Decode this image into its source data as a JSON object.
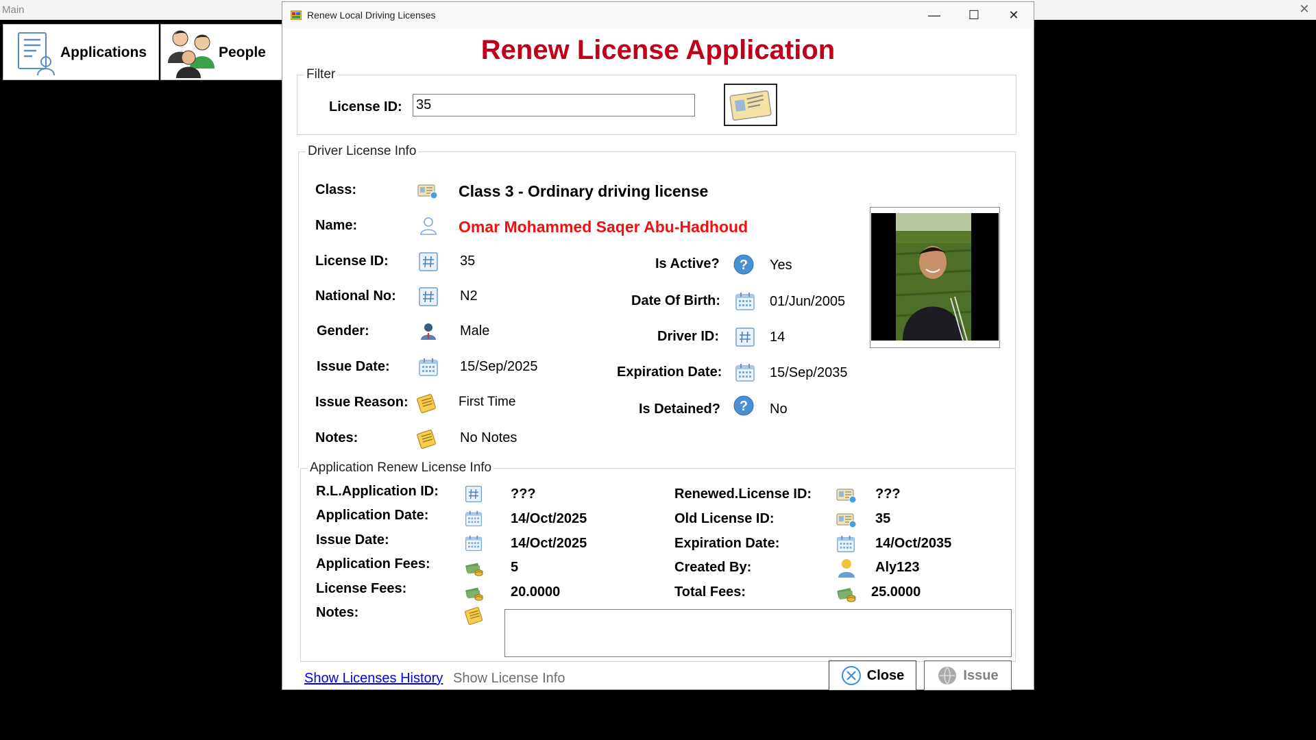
{
  "main_window": {
    "title": "Main",
    "close_glyph": "✕",
    "toolbar": {
      "applications_label": "Applications",
      "people_label": "People"
    }
  },
  "dialog": {
    "title": "Renew Local Driving Licenses",
    "controls": {
      "minimize": "—",
      "maximize": "☐",
      "close": "✕"
    },
    "heading": "Renew License Application",
    "heading_color": "#c0001b",
    "filter": {
      "group_title": "Filter",
      "license_id_label": "License ID:",
      "license_id_value": "35"
    },
    "driver_license_info": {
      "group_title": "Driver License Info",
      "class_label": "Class:",
      "class_value": "Class 3 - Ordinary driving license",
      "name_label": "Name:",
      "name_value": "Omar Mohammed Saqer Abu-Hadhoud",
      "license_id_label": "License ID:",
      "license_id_value": "35",
      "national_no_label": "National No:",
      "national_no_value": "N2",
      "gender_label": "Gender:",
      "gender_value": "Male",
      "issue_date_label": "Issue Date:",
      "issue_date_value": "15/Sep/2025",
      "issue_reason_label": "Issue Reason:",
      "issue_reason_value": "First Time",
      "notes_label": "Notes:",
      "notes_value": "No Notes",
      "is_active_label": "Is Active?",
      "is_active_value": "Yes",
      "date_of_birth_label": "Date Of Birth:",
      "date_of_birth_value": "01/Jun/2005",
      "driver_id_label": "Driver ID:",
      "driver_id_value": "14",
      "expiration_date_label": "Expiration Date:",
      "expiration_date_value": "15/Sep/2035",
      "is_detained_label": "Is Detained?",
      "is_detained_value": "No"
    },
    "application_renew_info": {
      "group_title": "Application Renew License Info",
      "rl_application_id_label": "R.L.Application ID:",
      "rl_application_id_value": "???",
      "application_date_label": "Application Date:",
      "application_date_value": "14/Oct/2025",
      "issue_date_label": "Issue Date:",
      "issue_date_value": "14/Oct/2025",
      "application_fees_label": "Application Fees:",
      "application_fees_value": "5",
      "license_fees_label": "License Fees:",
      "license_fees_value": "20.0000",
      "notes_label": "Notes:",
      "notes_value": "",
      "renewed_license_id_label": "Renewed.License ID:",
      "renewed_license_id_value": "???",
      "old_license_id_label": "Old License ID:",
      "old_license_id_value": "35",
      "expiration_date_label": "Expiration Date:",
      "expiration_date_value": "14/Oct/2035",
      "created_by_label": "Created By:",
      "created_by_value": "Aly123",
      "total_fees_label": "Total Fees:",
      "total_fees_value": "25.0000"
    },
    "footer": {
      "show_licenses_history": "Show Licenses History",
      "show_license_info": "Show License Info",
      "close_button": "Close",
      "issue_button": "Issue"
    }
  }
}
